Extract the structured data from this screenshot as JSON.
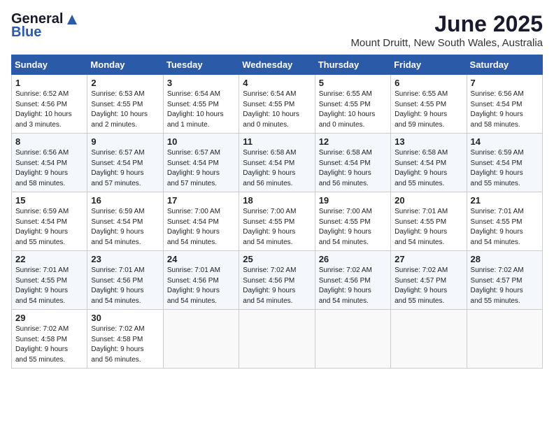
{
  "header": {
    "logo_general": "General",
    "logo_blue": "Blue",
    "month_title": "June 2025",
    "location": "Mount Druitt, New South Wales, Australia"
  },
  "weekdays": [
    "Sunday",
    "Monday",
    "Tuesday",
    "Wednesday",
    "Thursday",
    "Friday",
    "Saturday"
  ],
  "weeks": [
    [
      {
        "day": "1",
        "lines": [
          "Sunrise: 6:52 AM",
          "Sunset: 4:56 PM",
          "Daylight: 10 hours",
          "and 3 minutes."
        ]
      },
      {
        "day": "2",
        "lines": [
          "Sunrise: 6:53 AM",
          "Sunset: 4:55 PM",
          "Daylight: 10 hours",
          "and 2 minutes."
        ]
      },
      {
        "day": "3",
        "lines": [
          "Sunrise: 6:54 AM",
          "Sunset: 4:55 PM",
          "Daylight: 10 hours",
          "and 1 minute."
        ]
      },
      {
        "day": "4",
        "lines": [
          "Sunrise: 6:54 AM",
          "Sunset: 4:55 PM",
          "Daylight: 10 hours",
          "and 0 minutes."
        ]
      },
      {
        "day": "5",
        "lines": [
          "Sunrise: 6:55 AM",
          "Sunset: 4:55 PM",
          "Daylight: 10 hours",
          "and 0 minutes."
        ]
      },
      {
        "day": "6",
        "lines": [
          "Sunrise: 6:55 AM",
          "Sunset: 4:55 PM",
          "Daylight: 9 hours",
          "and 59 minutes."
        ]
      },
      {
        "day": "7",
        "lines": [
          "Sunrise: 6:56 AM",
          "Sunset: 4:54 PM",
          "Daylight: 9 hours",
          "and 58 minutes."
        ]
      }
    ],
    [
      {
        "day": "8",
        "lines": [
          "Sunrise: 6:56 AM",
          "Sunset: 4:54 PM",
          "Daylight: 9 hours",
          "and 58 minutes."
        ]
      },
      {
        "day": "9",
        "lines": [
          "Sunrise: 6:57 AM",
          "Sunset: 4:54 PM",
          "Daylight: 9 hours",
          "and 57 minutes."
        ]
      },
      {
        "day": "10",
        "lines": [
          "Sunrise: 6:57 AM",
          "Sunset: 4:54 PM",
          "Daylight: 9 hours",
          "and 57 minutes."
        ]
      },
      {
        "day": "11",
        "lines": [
          "Sunrise: 6:58 AM",
          "Sunset: 4:54 PM",
          "Daylight: 9 hours",
          "and 56 minutes."
        ]
      },
      {
        "day": "12",
        "lines": [
          "Sunrise: 6:58 AM",
          "Sunset: 4:54 PM",
          "Daylight: 9 hours",
          "and 56 minutes."
        ]
      },
      {
        "day": "13",
        "lines": [
          "Sunrise: 6:58 AM",
          "Sunset: 4:54 PM",
          "Daylight: 9 hours",
          "and 55 minutes."
        ]
      },
      {
        "day": "14",
        "lines": [
          "Sunrise: 6:59 AM",
          "Sunset: 4:54 PM",
          "Daylight: 9 hours",
          "and 55 minutes."
        ]
      }
    ],
    [
      {
        "day": "15",
        "lines": [
          "Sunrise: 6:59 AM",
          "Sunset: 4:54 PM",
          "Daylight: 9 hours",
          "and 55 minutes."
        ]
      },
      {
        "day": "16",
        "lines": [
          "Sunrise: 6:59 AM",
          "Sunset: 4:54 PM",
          "Daylight: 9 hours",
          "and 54 minutes."
        ]
      },
      {
        "day": "17",
        "lines": [
          "Sunrise: 7:00 AM",
          "Sunset: 4:54 PM",
          "Daylight: 9 hours",
          "and 54 minutes."
        ]
      },
      {
        "day": "18",
        "lines": [
          "Sunrise: 7:00 AM",
          "Sunset: 4:55 PM",
          "Daylight: 9 hours",
          "and 54 minutes."
        ]
      },
      {
        "day": "19",
        "lines": [
          "Sunrise: 7:00 AM",
          "Sunset: 4:55 PM",
          "Daylight: 9 hours",
          "and 54 minutes."
        ]
      },
      {
        "day": "20",
        "lines": [
          "Sunrise: 7:01 AM",
          "Sunset: 4:55 PM",
          "Daylight: 9 hours",
          "and 54 minutes."
        ]
      },
      {
        "day": "21",
        "lines": [
          "Sunrise: 7:01 AM",
          "Sunset: 4:55 PM",
          "Daylight: 9 hours",
          "and 54 minutes."
        ]
      }
    ],
    [
      {
        "day": "22",
        "lines": [
          "Sunrise: 7:01 AM",
          "Sunset: 4:55 PM",
          "Daylight: 9 hours",
          "and 54 minutes."
        ]
      },
      {
        "day": "23",
        "lines": [
          "Sunrise: 7:01 AM",
          "Sunset: 4:56 PM",
          "Daylight: 9 hours",
          "and 54 minutes."
        ]
      },
      {
        "day": "24",
        "lines": [
          "Sunrise: 7:01 AM",
          "Sunset: 4:56 PM",
          "Daylight: 9 hours",
          "and 54 minutes."
        ]
      },
      {
        "day": "25",
        "lines": [
          "Sunrise: 7:02 AM",
          "Sunset: 4:56 PM",
          "Daylight: 9 hours",
          "and 54 minutes."
        ]
      },
      {
        "day": "26",
        "lines": [
          "Sunrise: 7:02 AM",
          "Sunset: 4:56 PM",
          "Daylight: 9 hours",
          "and 54 minutes."
        ]
      },
      {
        "day": "27",
        "lines": [
          "Sunrise: 7:02 AM",
          "Sunset: 4:57 PM",
          "Daylight: 9 hours",
          "and 55 minutes."
        ]
      },
      {
        "day": "28",
        "lines": [
          "Sunrise: 7:02 AM",
          "Sunset: 4:57 PM",
          "Daylight: 9 hours",
          "and 55 minutes."
        ]
      }
    ],
    [
      {
        "day": "29",
        "lines": [
          "Sunrise: 7:02 AM",
          "Sunset: 4:58 PM",
          "Daylight: 9 hours",
          "and 55 minutes."
        ]
      },
      {
        "day": "30",
        "lines": [
          "Sunrise: 7:02 AM",
          "Sunset: 4:58 PM",
          "Daylight: 9 hours",
          "and 56 minutes."
        ]
      },
      null,
      null,
      null,
      null,
      null
    ]
  ]
}
